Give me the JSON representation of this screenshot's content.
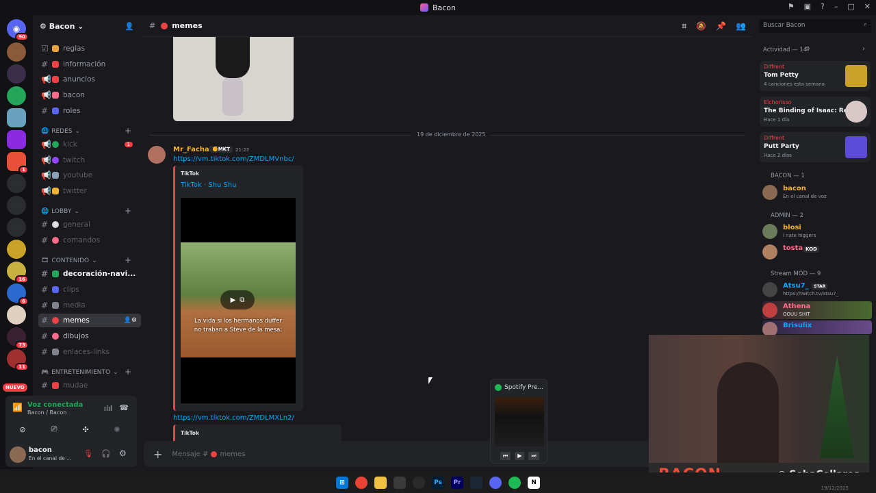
{
  "window": {
    "title": "Bacon"
  },
  "server": {
    "name": "Bacon",
    "channels_top": [
      {
        "label": "reglas",
        "color": "#e8a33d"
      },
      {
        "label": "información",
        "color": "#ed4245"
      },
      {
        "label": "anuncios",
        "color": "#ed4245"
      },
      {
        "label": "bacon",
        "color": "#ff6b8a"
      },
      {
        "label": "roles",
        "color": "#5865f2"
      }
    ],
    "categories": {
      "redes": "REDES",
      "lobby": "LOBBY",
      "contenido": "CONTENIDO",
      "entretenimiento": "ENTRETENIMIENTO"
    },
    "redes": [
      {
        "label": "kick",
        "color": "#23a55a",
        "badge": "1"
      },
      {
        "label": "twitch",
        "color": "#9146ff"
      },
      {
        "label": "youtube",
        "color": "#8aa0b8"
      },
      {
        "label": "twitter",
        "color": "#f0b232"
      }
    ],
    "lobby": [
      {
        "label": "general",
        "color": "#dbdee1"
      },
      {
        "label": "comandos",
        "color": "#ff6b8a"
      }
    ],
    "contenido": [
      {
        "label": "decoración-navi...",
        "color": "#23a55a"
      },
      {
        "label": "clips",
        "color": "#5865f2"
      },
      {
        "label": "media",
        "color": "#80848e"
      },
      {
        "label": "memes",
        "color": "#ed4245"
      },
      {
        "label": "dibujos",
        "color": "#ff6b8a"
      },
      {
        "label": "enlaces-links",
        "color": "#80848e"
      }
    ],
    "entretenimiento": [
      {
        "label": "mudae",
        "color": "#ed4245"
      }
    ]
  },
  "server_badges": [
    "90",
    "1",
    "16",
    "6",
    "73",
    "11"
  ],
  "nuevo": "NUEVO",
  "voice": {
    "title": "Voz conectada",
    "sub": "Bacon / Bacon"
  },
  "user": {
    "name": "bacon",
    "status": "En el canal de ..."
  },
  "channel": {
    "name": "memes",
    "date_divider": "19 de diciembre de 2025",
    "message": {
      "author": "Mr_Facha7",
      "tag": "MKT",
      "time": "21:22",
      "link1": "https://vm.tiktok.com/ZMDLMVnbc/",
      "embed_provider": "TikTok",
      "embed_title": "TikTok · Shu Shu",
      "caption": "La vida si los hermanos duffer no traban a Steve de la mesa:",
      "link2": "https://vm.tiktok.com/ZMDLMXLn2/",
      "embed2_provider": "TikTok"
    },
    "input_placeholder": "Mensaje #",
    "input_channel": "memes"
  },
  "search": {
    "placeholder": "Buscar Bacon"
  },
  "activity": {
    "header": "Actividad — 14",
    "cards": [
      {
        "who": "Diffrent",
        "title": "Tom Petty",
        "sub": "4 canciones esta semana",
        "art": "#c9a227"
      },
      {
        "who": "Elchorisso",
        "title": "The Binding of Isaac: Rebirth",
        "sub": "Hace 1 día",
        "art": "#d8c8c8"
      },
      {
        "who": "Diffrent",
        "title": "Putt Party",
        "sub": "Hace 2 días",
        "art": "#5b4bd6"
      }
    ]
  },
  "members": {
    "groups": [
      {
        "label": "BACON — 1"
      },
      {
        "label": "ADMIN — 2"
      },
      {
        "label": "Stream MOD — 9"
      }
    ],
    "list": [
      {
        "name": "bacon",
        "sub": "En el canal de voz",
        "color": "#f0b232",
        "av": "#8a6a52"
      },
      {
        "name": "blosi",
        "sub": "i nate higgers",
        "color": "#f0b232",
        "av": "#6a7a5a"
      },
      {
        "name": "tosta",
        "sub": "",
        "tag": "KOD",
        "color": "#ff6b8a",
        "av": "#b08060"
      },
      {
        "name": "Atsu7_",
        "sub": "https://twitch.tv/atsu7_",
        "tag": "STAR",
        "color": "#00a8fc",
        "av": "#444"
      },
      {
        "name": "Athena",
        "sub": "OOUU SHIT",
        "color": "#ff6b8a",
        "av": "#c04040"
      },
      {
        "name": "Brisulix",
        "sub": "",
        "color": "#00a8fc",
        "av": "#a07070"
      }
    ]
  },
  "spotify": {
    "label": "Spotify Pre..."
  },
  "webcam": {
    "brand": "BACON",
    "handle": "SebaCollares"
  },
  "taskbar": {
    "time": "19/12/2025"
  }
}
